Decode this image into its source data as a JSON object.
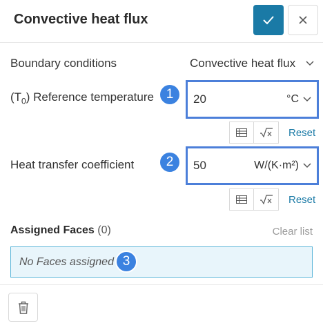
{
  "header": {
    "title": "Convective heat flux",
    "confirm_icon": "checkmark-icon",
    "close_icon": "close-icon"
  },
  "boundary": {
    "label": "Boundary conditions",
    "value": "Convective heat flux",
    "icon": "chevron-down-icon"
  },
  "reference_temperature": {
    "label_prefix": "(T",
    "label_sub": "0",
    "label_suffix": ") Reference temperature",
    "value": "20",
    "unit": "°C",
    "badge": "1",
    "reset": "Reset"
  },
  "heat_transfer": {
    "label": "Heat transfer coefficient",
    "value": "50",
    "unit": "W/(K·m²)",
    "badge": "2",
    "reset": "Reset"
  },
  "assigned": {
    "title": "Assigned Faces",
    "count": "(0)",
    "clear": "Clear list",
    "empty": "No Faces assigned",
    "badge": "3"
  },
  "colors": {
    "accent": "#1a7aa6",
    "badge": "#3b82e0",
    "field_border": "#4c7fd9",
    "faces_bg": "#e8f5fb"
  }
}
